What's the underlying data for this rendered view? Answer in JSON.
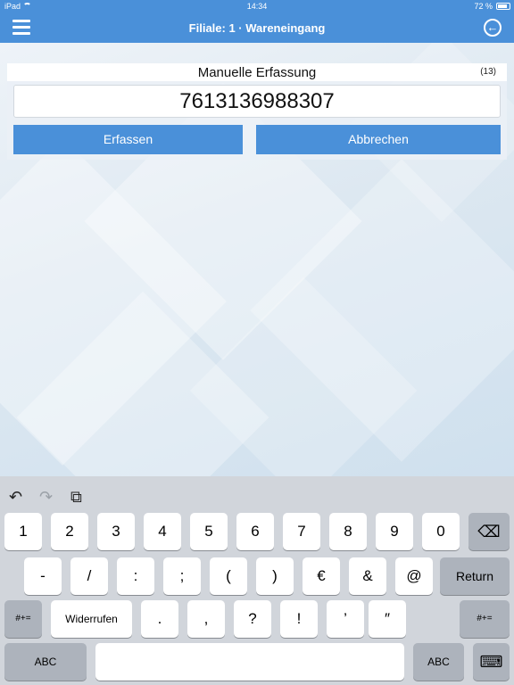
{
  "status_bar": {
    "device": "iPad",
    "time": "14:34",
    "battery": "72 %"
  },
  "nav": {
    "title": "Filiale: 1 · Wareneingang",
    "menu_icon": "hamburger-menu-icon",
    "back_icon": "back-circle-icon"
  },
  "panel": {
    "title": "Manuelle Erfassung",
    "count": "(13)",
    "code_value": "7613136988307",
    "submit_label": "Erfassen",
    "cancel_label": "Abbrechen"
  },
  "keyboard": {
    "tools": {
      "undo": "↶",
      "redo": "↷",
      "paste": "⧉"
    },
    "row1": [
      "1",
      "2",
      "3",
      "4",
      "5",
      "6",
      "7",
      "8",
      "9",
      "0"
    ],
    "backspace": "⌫",
    "row2": [
      "-",
      "/",
      ":",
      ";",
      "(",
      ")",
      "€",
      "&",
      "@"
    ],
    "return_label": "Return",
    "row3_left": "#+=",
    "undo_label": "Widerrufen",
    "row3": [
      ".",
      ",",
      "?",
      "!",
      "’",
      "″"
    ],
    "row3_right": "#+=",
    "abc_left": "ABC",
    "abc_right": "ABC",
    "hide_icon": "⌨"
  },
  "colors": {
    "accent": "#4a90d9",
    "keyboard_bg": "#d1d5db"
  }
}
